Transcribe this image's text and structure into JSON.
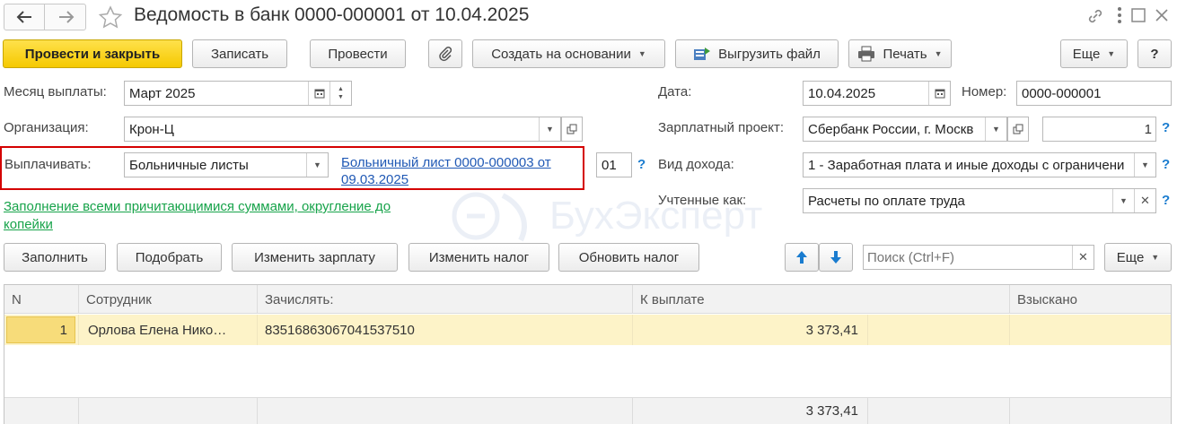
{
  "window": {
    "title": "Ведомость в банк 0000-000001 от 10.04.2025",
    "icons": [
      "arrow-left-icon",
      "arrow-right-icon",
      "star-icon",
      "link-icon",
      "more-icon",
      "maximize-icon",
      "close-icon"
    ]
  },
  "toolbar": {
    "post_close": "Провести и закрыть",
    "save": "Записать",
    "post": "Провести",
    "create_based": "Создать на основании",
    "export_file": "Выгрузить файл",
    "print": "Печать",
    "more": "Еще",
    "help": "?"
  },
  "form": {
    "month_label": "Месяц выплаты:",
    "month_value": "Март 2025",
    "org_label": "Организация:",
    "org_value": "Крон-Ц",
    "pay_label": "Выплачивать:",
    "pay_value": "Больничные листы",
    "sick_link_line1": "Больничный лист 0000-000003 от",
    "sick_link_line2": "09.03.2025",
    "code_value": "01",
    "date_label": "Дата:",
    "date_value": "10.04.2025",
    "number_label": "Номер:",
    "number_value": "0000-000001",
    "salary_project_label": "Зарплатный проект:",
    "salary_project_value": "Сбербанк России, г. Москв",
    "salary_project_count": "1",
    "income_type_label": "Вид дохода:",
    "income_type_value": "1 - Заработная плата и иные доходы с ограничени",
    "accounted_label": "Учтенные как:",
    "accounted_value": "Расчеты по оплате труда",
    "fill_link_line1": "Заполнение всеми причитающимися суммами, округление до",
    "fill_link_line2": "копейки",
    "help": "?"
  },
  "watermark": "БухЭксперт",
  "table_toolbar": {
    "fill": "Заполнить",
    "pick": "Подобрать",
    "change_salary": "Изменить зарплату",
    "change_tax": "Изменить налог",
    "update_tax": "Обновить налог",
    "search_placeholder": "Поиск (Ctrl+F)",
    "more": "Еще"
  },
  "table": {
    "columns": [
      "N",
      "Сотрудник",
      "Зачислять:",
      "К выплате",
      "Взыскано"
    ],
    "rows": [
      {
        "n": "1",
        "employee": "Орлова Елена Нико…",
        "account": "83516863067041537510",
        "to_pay": "3 373,41",
        "withheld": ""
      }
    ],
    "total_to_pay": "3 373,41"
  },
  "colors": {
    "primary_button": "#f5c900",
    "highlight_border": "#d40000",
    "link": "#2059b5",
    "green_link": "#17a34a",
    "row_selected": "#fdf3c8"
  }
}
